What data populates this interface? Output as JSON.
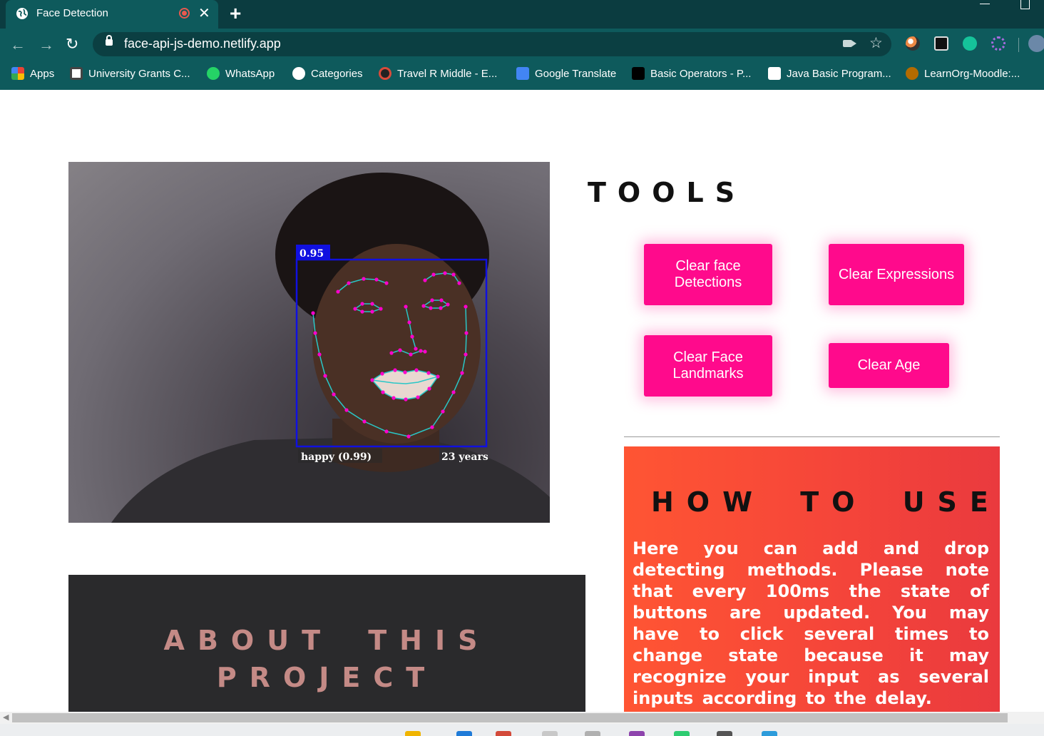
{
  "browser": {
    "tab_title": "Face Detection",
    "tab_close": "✕",
    "new_tab": "+",
    "url": "face-api-js-demo.netlify.app",
    "back": "←",
    "forward": "→",
    "reload": "↻",
    "star": "☆"
  },
  "bookmarks": [
    {
      "label": "Apps",
      "icon": "apps-grid-icon",
      "color": "#f4b400"
    },
    {
      "label": "University Grants C...",
      "icon": "ugc-icon",
      "color": "#ffffff"
    },
    {
      "label": "WhatsApp",
      "icon": "whatsapp-icon",
      "color": "#25d366"
    },
    {
      "label": "Categories",
      "icon": "globe-icon",
      "color": "#ffffff"
    },
    {
      "label": "Travel R Middle - E...",
      "icon": "travel-icon",
      "color": "#d94a3a"
    },
    {
      "label": "Google Translate",
      "icon": "google-translate-icon",
      "color": "#4285f4"
    },
    {
      "label": "Basic Operators - P...",
      "icon": "sf-icon",
      "color": "#000000"
    },
    {
      "label": "Java Basic Program...",
      "icon": "w3r-icon",
      "color": "#ffffff"
    },
    {
      "label": "LearnOrg-Moodle:...",
      "icon": "moodle-icon",
      "color": "#b36b00"
    }
  ],
  "video": {
    "box_score": "0.95",
    "expression": "happy (0.99)",
    "age": "23 years"
  },
  "tools": {
    "title": "TOOLS",
    "buttons": [
      {
        "label": "Clear face Detections"
      },
      {
        "label": "Clear Expressions"
      },
      {
        "label": "Clear Face Landmarks"
      },
      {
        "label": "Clear Age"
      }
    ]
  },
  "howto": {
    "title": "HOW TO USE",
    "text": "Here you can add and drop detecting methods. Please note that every 100ms the state of buttons are updated. You may have to click several times to change state because it may recognize your input as several inputs according to the delay."
  },
  "about": {
    "title": "ABOUT THIS PROJECT"
  },
  "colors": {
    "accent_button": "#ff0a8c",
    "howto_bg": "#f4443a",
    "about_bg": "#2a2a2c",
    "about_title": "#c48a86",
    "chrome": "#0e5a5c"
  }
}
